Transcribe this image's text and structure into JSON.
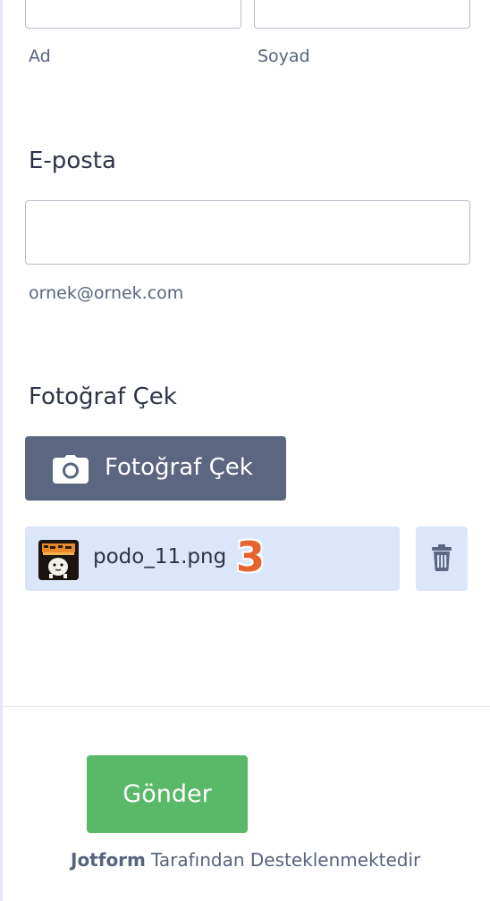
{
  "name_field": {
    "first_sublabel": "Ad",
    "last_sublabel": "Soyad"
  },
  "email_field": {
    "label": "E-posta",
    "value": "",
    "sublabel": "ornek@ornek.com"
  },
  "photo_field": {
    "label": "Fotoğraf Çek",
    "button_label": "Fotoğraf Çek",
    "button_icon": "camera-icon",
    "file_name": "podo_11.png",
    "step_badge": "3",
    "delete_icon": "trash-icon"
  },
  "submit": {
    "label": "Gönder"
  },
  "footer": {
    "brand": "Jotform",
    "text": "Tarafından Desteklenmektedir"
  },
  "colors": {
    "button_dark": "#5b6680",
    "submit_green": "#5ab968",
    "file_chip_bg": "#dce6fb",
    "badge_orange": "#e8622b"
  }
}
